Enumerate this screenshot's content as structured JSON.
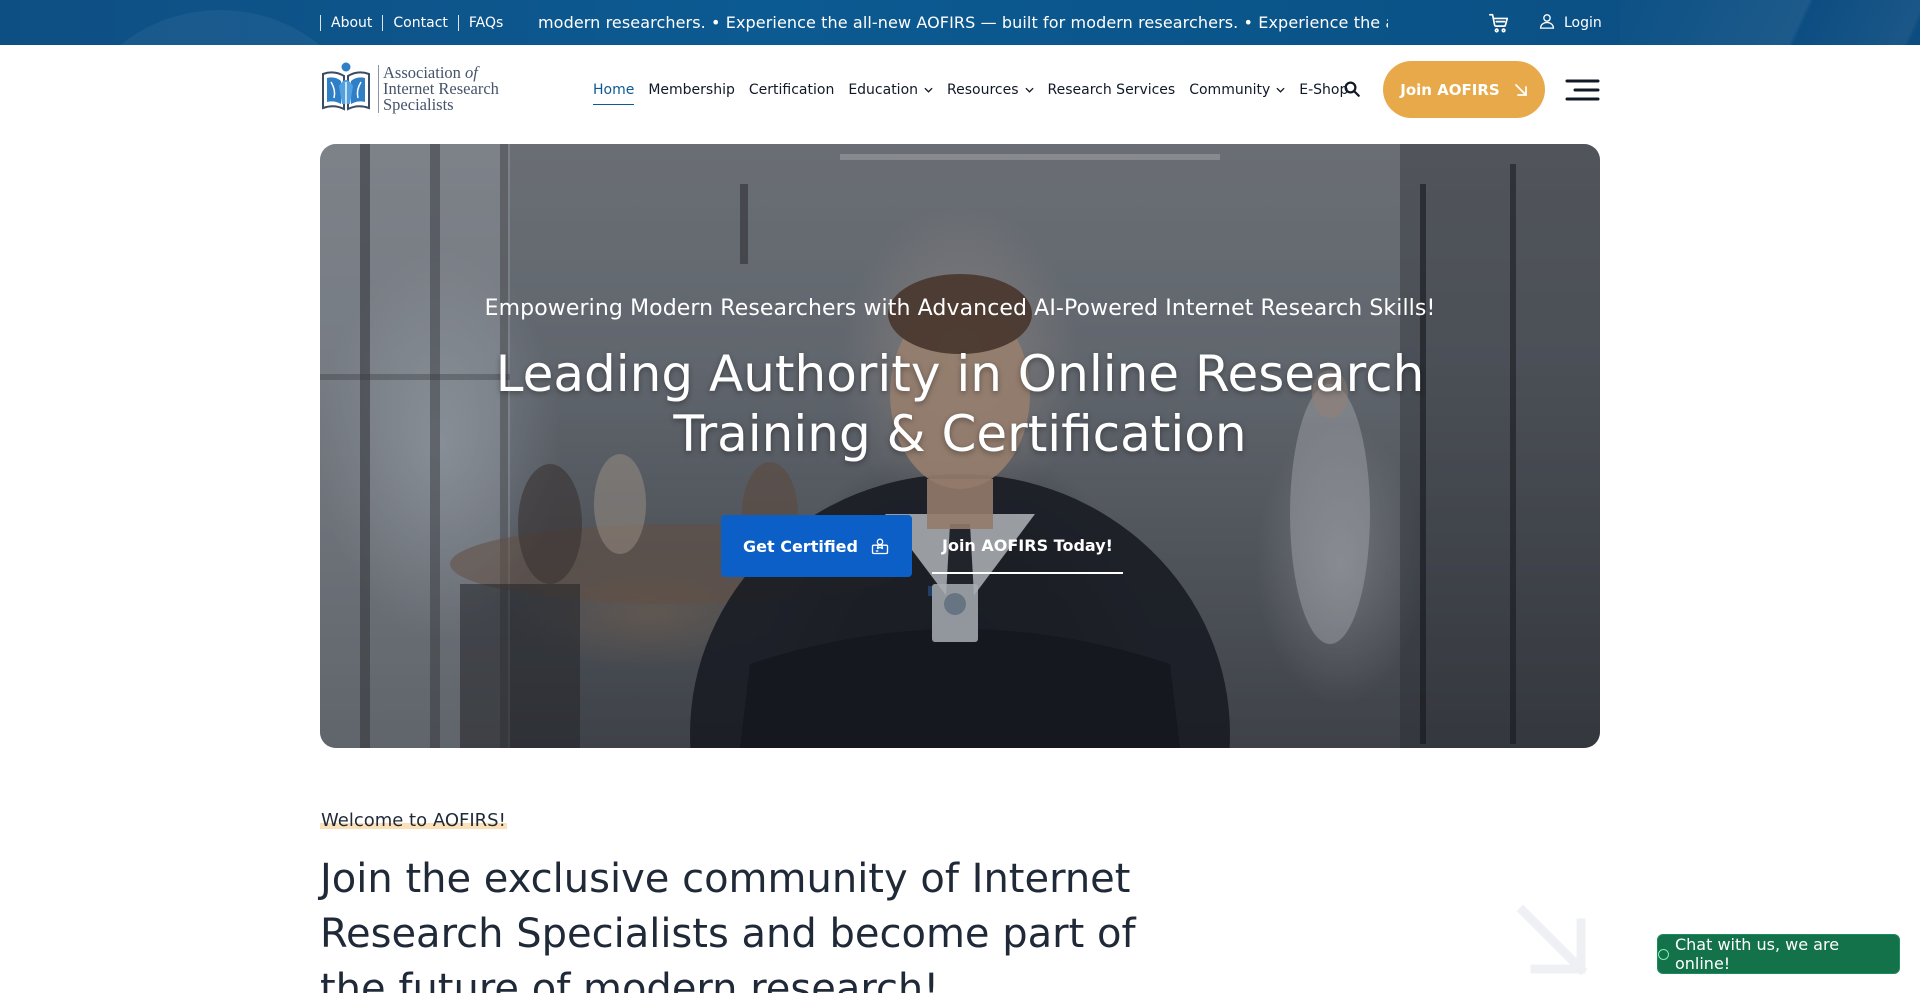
{
  "topbar": {
    "links": [
      "About",
      "Contact",
      "FAQs"
    ],
    "marquee": "modern researchers. • Experience the all-new AOFIRS — built for modern researchers. • Experience the all-new",
    "login_label": "Login"
  },
  "header": {
    "logo": {
      "line1": "Association",
      "line1_italic": "of",
      "line2": "Internet Research",
      "line3": "Specialists"
    },
    "nav": [
      {
        "label": "Home",
        "active": true
      },
      {
        "label": "Membership"
      },
      {
        "label": "Certification"
      },
      {
        "label": "Education",
        "dropdown": true
      },
      {
        "label": "Resources",
        "dropdown": true
      },
      {
        "label": "Research Services"
      },
      {
        "label": "Community",
        "dropdown": true
      },
      {
        "label": "E-Shop"
      }
    ],
    "join_label": "Join AOFIRS",
    "accent_color": "#e8a94a",
    "brand_color": "#0b5a93"
  },
  "hero": {
    "subtitle": "Empowering  Modern Researchers with Advanced AI-Powered Internet Research Skills!",
    "title": "Leading Authority in Online Research Training & Certification",
    "primary_button": "Get Certified",
    "secondary_button": "Join AOFIRS Today!"
  },
  "welcome": {
    "tag": "Welcome to AOFIRS!",
    "heading": "Join the exclusive community of Internet Research Specialists and become part of the future of modern research!"
  },
  "chat": {
    "label": "Chat with us, we are online!"
  }
}
